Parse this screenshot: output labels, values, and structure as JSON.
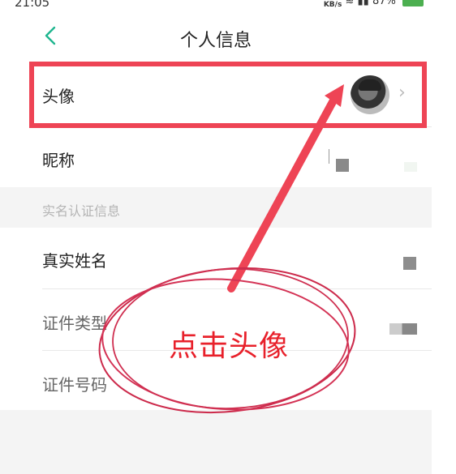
{
  "status_bar": {
    "time": "21:05",
    "network_speed_unit": "KB/s",
    "battery": "87%"
  },
  "header": {
    "title": "个人信息"
  },
  "profile": {
    "avatar_label": "头像",
    "nickname_label": "昵称"
  },
  "section": {
    "title": "实名认证信息"
  },
  "identity": {
    "real_name_label": "真实姓名",
    "id_type_label": "证件类型",
    "id_number_label": "证件号码"
  },
  "annotation": {
    "text": "点击头像",
    "color": "#e8212b",
    "highlight_color": "#ee4455"
  },
  "icons": {
    "back": "chevron-left-icon",
    "row_arrow": "chevron-right-icon"
  },
  "colors": {
    "accent": "#1fb58f",
    "page_bg": "#f4f4f4"
  }
}
